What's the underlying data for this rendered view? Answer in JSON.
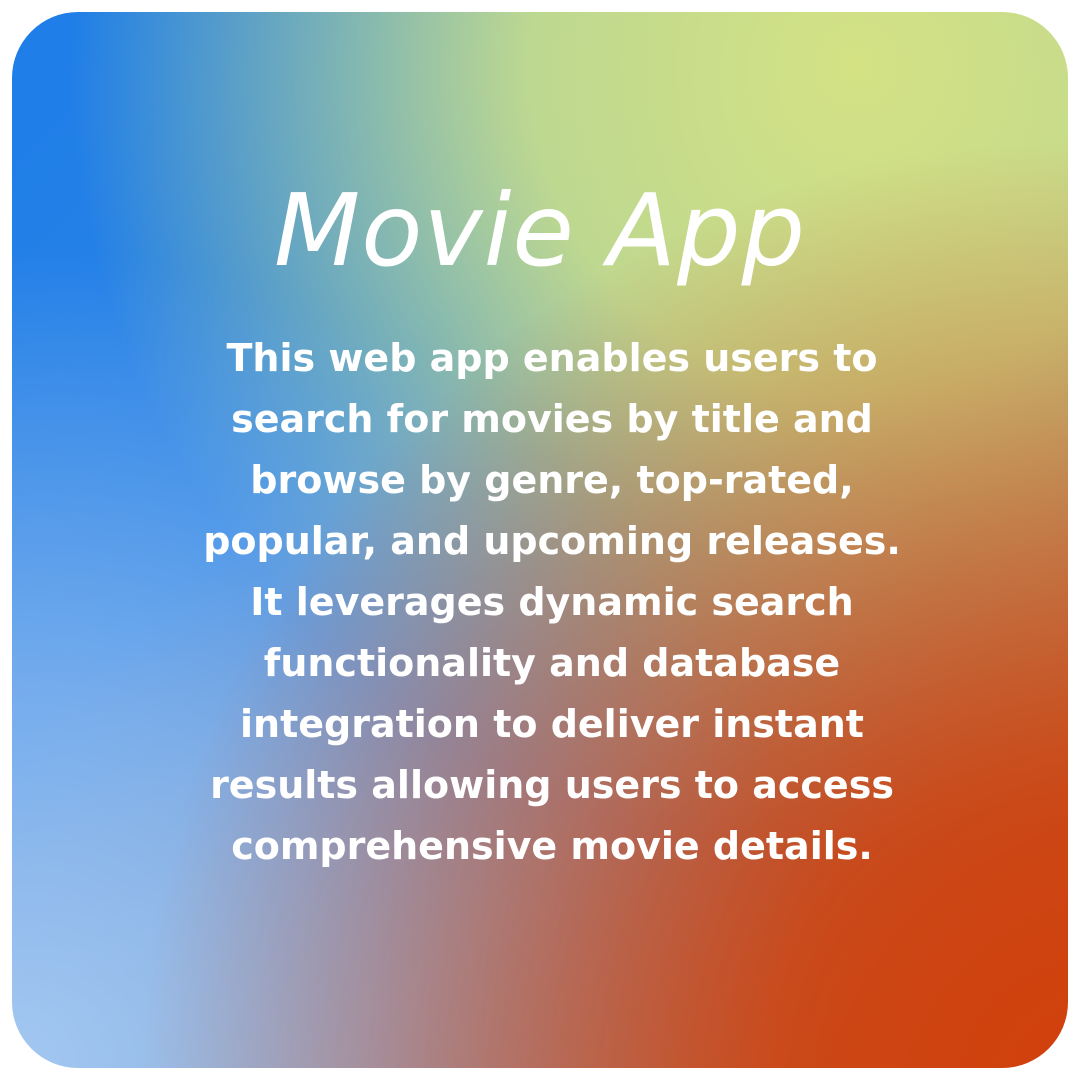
{
  "card": {
    "title": "Movie App",
    "description": "This web app enables users to search for movies by title and browse by genre, top-rated, popular, and upcoming releases. It leverages dynamic search functionality and database integration to deliver instant results allowing users to access comprehensive movie details.",
    "colors": {
      "top_left": "#1e7de8",
      "top_right": "#d4e284",
      "bottom_left": "#a3c8f2",
      "bottom_right": "#d0400c",
      "text": "#ffffff"
    }
  }
}
